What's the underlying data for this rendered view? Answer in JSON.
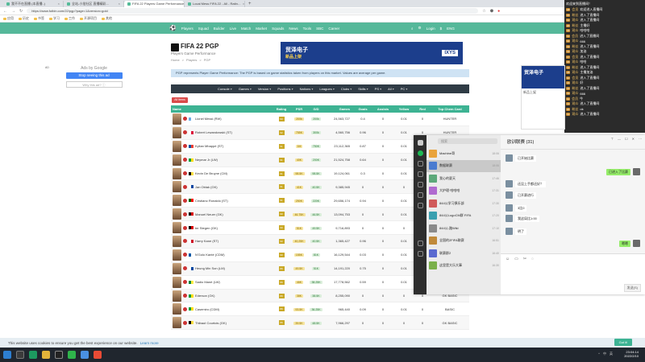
{
  "browser": {
    "tabs": [
      {
        "label": "我不不在直播 (本直播..)",
        "active": false
      },
      {
        "label": "全站-小批社区 直播精彩…",
        "active": false
      },
      {
        "label": "FIFA 22 Players Game Performance",
        "active": true
      },
      {
        "label": "Local Mess FIFA 22 - All - Ratin…",
        "active": false
      }
    ],
    "url": "https://www.futbin.com/22/pgp?page=1&version=gold",
    "bookmarks": [
      "应用",
      "历史",
      "书签",
      "学习",
      "工作",
      "开源项目",
      "其他"
    ]
  },
  "site_nav": {
    "items": [
      "Players",
      "Squad",
      "Builder",
      "Live",
      "Match",
      "Market",
      "Squads",
      "News",
      "Tools",
      "SBC",
      "Career"
    ],
    "right": [
      "Login",
      "$",
      "ENG"
    ]
  },
  "left_ad": {
    "tag": "AD",
    "label": "Ads by Google",
    "button": "Stop seeing this ad",
    "why": "Why this ad? ⓘ"
  },
  "header": {
    "title": "FIFA 22 PGP",
    "subtitle": "Players Game Performance",
    "breadcrumbs": [
      "Home",
      ">",
      "Players",
      ">",
      "PGP"
    ]
  },
  "banner": {
    "line1": "贸泽电子",
    "line2": "新品上架",
    "brand": "IXYS"
  },
  "info": "PGP represents Player Game Performance: The PGP is based on game statistics taken from players on this market. Values are average per game.",
  "filters": [
    "Console",
    "Games",
    "Version",
    "Positions",
    "Nations",
    "Leagues",
    "Clubs",
    "Skills",
    "PS",
    "All",
    "PC"
  ],
  "all_button": "All Items",
  "table": {
    "headers": [
      "Name",
      "Rating",
      "PSR",
      "G/D",
      "Games",
      "Goals",
      "Assists",
      "Yellow",
      "Red",
      "Top Chem Card"
    ],
    "rows": [
      {
        "name": "Lionel Messi (RW)",
        "rating": "93",
        "psr": "200k",
        "gd": "200k",
        "games": "24,563,727",
        "goals": "0.4",
        "assists": "0",
        "yellow": "0.01",
        "red": "0",
        "card": "HUNTER"
      },
      {
        "name": "Robert Lewandowski (ST)",
        "rating": "92",
        "psr": "755K",
        "gd": "300k",
        "games": "4,560,756",
        "goals": "0.96",
        "assists": "0",
        "yellow": "0.01",
        "red": "0",
        "card": "HUNTER"
      },
      {
        "name": "Kylian Mbappé (ST)",
        "rating": "91",
        "psr": "1M",
        "gd": "750K",
        "games": "23,112,365",
        "goals": "0.87",
        "assists": "0",
        "yellow": "0.01",
        "red": "0",
        "card": "HUNTER"
      },
      {
        "name": "Neymar Jr (LW)",
        "rating": "91",
        "psr": "40K",
        "gd": "200K",
        "games": "21,524,758",
        "goals": "0.64",
        "assists": "0",
        "yellow": "0.01",
        "red": "0",
        "card": "HUNTER"
      },
      {
        "name": "Kevin De Bruyne (CM)",
        "rating": "91",
        "psr": "98.5K",
        "gd": "98.5K",
        "games": "19,124,061",
        "goals": "0.3",
        "assists": "0",
        "yellow": "0.01",
        "red": "0",
        "card": "HUNTER"
      },
      {
        "name": "Jan Oblak (GK)",
        "rating": "91",
        "psr": "41K",
        "gd": "40.5K",
        "games": "9,385,945",
        "goals": "0",
        "assists": "0",
        "yellow": "0",
        "red": "0",
        "card": ""
      },
      {
        "name": "Cristiano Ronaldo (ST)",
        "rating": "91",
        "psr": "250K",
        "gd": "220K",
        "games": "29,656,174",
        "goals": "0.94",
        "assists": "0",
        "yellow": "0.01",
        "red": "0",
        "card": "HUNTER"
      },
      {
        "name": "Manuel Neuer (GK)",
        "rating": "90",
        "psr": "46.75K",
        "gd": "46.5K",
        "games": "13,094,753",
        "goals": "0",
        "assists": "0",
        "yellow": "0.01",
        "red": "0",
        "card": ""
      },
      {
        "name": "ter Stegen (GK)",
        "rating": "90",
        "psr": "51K",
        "gd": "49.5K",
        "games": "9,716,893",
        "goals": "0",
        "assists": "0",
        "yellow": "0",
        "red": "0",
        "card": ""
      },
      {
        "name": "Harry Kane (ST)",
        "rating": "90",
        "psr": "40,25K",
        "gd": "40.5K",
        "games": "1,365,427",
        "goals": "0.96",
        "assists": "0",
        "yellow": "0.01",
        "red": "0",
        "card": "HUNTER"
      },
      {
        "name": "N'Golo Kanté (CDM)",
        "rating": "90",
        "psr": "155K",
        "gd": "81K",
        "games": "16,129,544",
        "goals": "0.03",
        "assists": "0",
        "yellow": "0.01",
        "red": "0",
        "card": "HUNTER"
      },
      {
        "name": "Heung Min Son (LM)",
        "rating": "89",
        "psr": "49.5K",
        "gd": "51K",
        "games": "14,191,220",
        "goals": "0.75",
        "assists": "0",
        "yellow": "0.01",
        "red": "0",
        "card": "HUNTER"
      },
      {
        "name": "Sadio Mané (LW)",
        "rating": "89",
        "psr": "46K",
        "gd": "38.25K",
        "games": "17,778,562",
        "goals": "0.59",
        "assists": "0",
        "yellow": "0.01",
        "red": "0",
        "card": "HUNTER"
      },
      {
        "name": "Ederson (GK)",
        "rating": "89",
        "psr": "38K",
        "gd": "38.5K",
        "games": "8,255,090",
        "goals": "0",
        "assists": "0",
        "yellow": "0",
        "red": "0",
        "card": "GK BASIC"
      },
      {
        "name": "Casemiro (CDM)",
        "rating": "89",
        "psr": "93.5K",
        "gd": "36.25K",
        "games": "965,440",
        "goals": "0.09",
        "assists": "0",
        "yellow": "0.01",
        "red": "0",
        "card": "BASIC"
      },
      {
        "name": "Thibaut Courtois (GK)",
        "rating": "89",
        "psr": "39.5K",
        "gd": "48.5K",
        "games": "7,966,297",
        "goals": "0",
        "assists": "0",
        "yellow": "0",
        "red": "0",
        "card": "GK BASIC"
      }
    ]
  },
  "chat": {
    "header": "欢迎来到直播间！",
    "messages": [
      {
        "lv": "18",
        "user": "会员",
        "text": "欢迎进入直播间"
      },
      {
        "lv": "15",
        "user": "粉丝",
        "text": "进入了直播间"
      },
      {
        "lv": "12",
        "user": "观众",
        "text": "进入了直播间"
      },
      {
        "lv": "20",
        "user": "粉丝",
        "text": "主播好"
      },
      {
        "lv": "16",
        "user": "观众",
        "text": "哈哈哈"
      },
      {
        "lv": "11",
        "user": "会员",
        "text": "进入了直播间"
      },
      {
        "lv": "14",
        "user": "观众",
        "text": "666"
      },
      {
        "lv": "19",
        "user": "粉丝",
        "text": "进入了直播间"
      },
      {
        "lv": "13",
        "user": "观众",
        "text": "加油"
      },
      {
        "lv": "17",
        "user": "会员",
        "text": "进入了直播间"
      },
      {
        "lv": "15",
        "user": "观众",
        "text": "哈哈"
      },
      {
        "lv": "12",
        "user": "粉丝",
        "text": "进入了直播间"
      },
      {
        "lv": "18",
        "user": "观众",
        "text": "主播加油"
      },
      {
        "lv": "10",
        "user": "会员",
        "text": "进入了直播间"
      },
      {
        "lv": "16",
        "user": "观众",
        "text": "好"
      },
      {
        "lv": "14",
        "user": "粉丝",
        "text": "进入了直播间"
      },
      {
        "lv": "19",
        "user": "观众",
        "text": "666"
      },
      {
        "lv": "11",
        "user": "会员",
        "text": "牛"
      },
      {
        "lv": "13",
        "user": "观众",
        "text": "进入了直播间"
      },
      {
        "lv": "20",
        "user": "粉丝",
        "text": "ok"
      },
      {
        "lv": "12",
        "user": "观众",
        "text": "进入了直播间"
      }
    ]
  },
  "right_ad": {
    "title": "贸泽电子",
    "text": "新品上架"
  },
  "qq": {
    "search": "搜索",
    "title": "欧训联赛 (31)",
    "conversations": [
      {
        "name": "Machine哥",
        "time": "18:06"
      },
      {
        "name": "数据联赛",
        "time": "18:06"
      },
      {
        "name": "我心的夏天",
        "time": "17:46"
      },
      {
        "name": "大护理·哈哈哈",
        "time": "17:31"
      },
      {
        "name": "844公学习俱乐部",
        "time": "17:30"
      },
      {
        "name": "844公LogoCM群 FIFA",
        "time": "17:20"
      },
      {
        "name": "844公-路Wiki",
        "time": "17:10"
      },
      {
        "name": "全国的2FIFA联赛",
        "time": "16:51"
      },
      {
        "name": "联赛群2",
        "time": "16:40"
      },
      {
        "name": "这里是大乐大事",
        "time": "16:30"
      }
    ],
    "messages": [
      {
        "me": false,
        "text": "已开始比赛"
      },
      {
        "me": true,
        "text": "已进入了比赛"
      },
      {
        "me": false,
        "text": "还没上手都还好？"
      },
      {
        "me": false,
        "text": "已开赛进行"
      },
      {
        "me": false,
        "text": "3比0"
      },
      {
        "me": false,
        "text": "我这局比1:00"
      },
      {
        "me": false,
        "text": "明了"
      },
      {
        "me": true,
        "text": "嗯嗯"
      }
    ],
    "send": "发送(S)"
  },
  "cookie": {
    "text": "This website uses cookies to ensure you get the best experience on our website.",
    "link": "Learn more",
    "button": "Got it!"
  },
  "taskbar": {
    "time": "23:04:14",
    "date": "2022/2/10",
    "tray": [
      "^",
      "中",
      "英"
    ]
  }
}
